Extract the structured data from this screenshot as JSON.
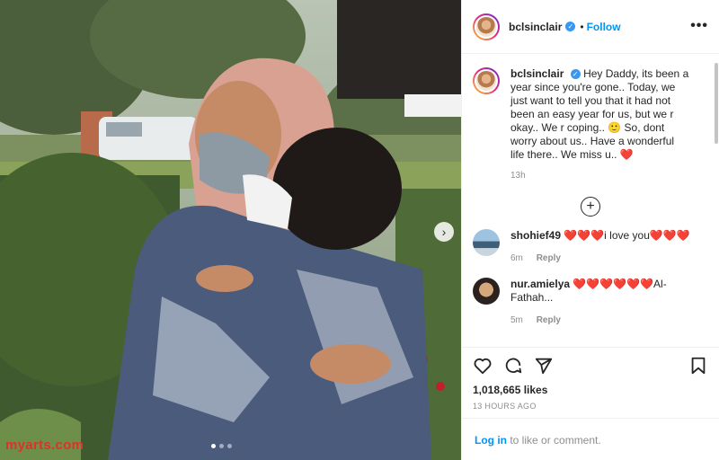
{
  "post": {
    "username": "bclsinclair",
    "follow_separator": "•",
    "follow_label": "Follow",
    "more_label": "•••",
    "watermark": "myarts.com",
    "caption": "Hey Daddy, its been a year since you're gone.. Today, we just want to tell you that it had not been an easy year for us, but we r okay.. We r coping.. 🙂 So, dont worry about us.. Have a wonderful life there.. We miss u.. ❤️",
    "caption_time": "13h",
    "load_more_label": "+",
    "comments": [
      {
        "username": "shohief49",
        "text": "❤️❤️❤️i love you❤️❤️❤️",
        "time": "6m",
        "reply": "Reply",
        "avatar_color": "#7fa8c9"
      },
      {
        "username": "nur.amielya",
        "text": "❤️❤️❤️❤️❤️❤️Al-Fathah...",
        "time": "5m",
        "reply": "Reply",
        "avatar_color": "#c9a27f"
      }
    ],
    "likes": "1,018,665 likes",
    "posted_ago": "13 HOURS AGO",
    "login_link": "Log in",
    "login_text": " to like or comment.",
    "carousel_arrow": "›"
  },
  "icons": [
    "heart-icon",
    "comment-icon",
    "share-icon",
    "bookmark-icon",
    "verified-icon",
    "plus-circle-icon",
    "chevron-right-icon"
  ],
  "colors": {
    "accent": "#0095f6",
    "verified": "#3897f0",
    "watermark": "#e0302a"
  }
}
